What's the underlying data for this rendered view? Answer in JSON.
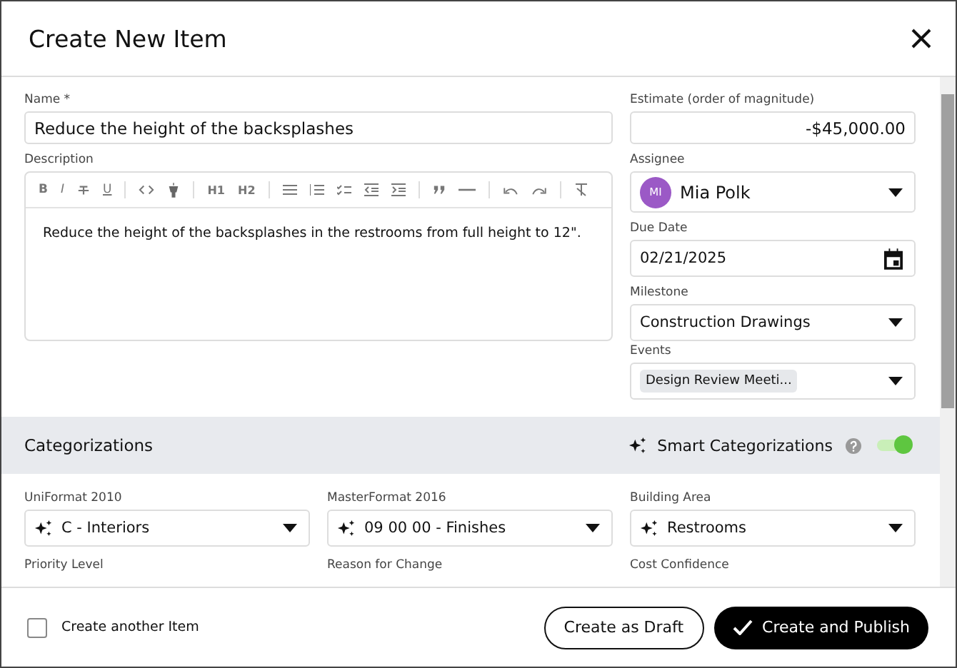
{
  "dialog": {
    "title": "Create New Item"
  },
  "name_field": {
    "label": "Name",
    "required_mark": "*",
    "value": "Reduce the height of the backsplashes"
  },
  "description": {
    "label": "Description",
    "toolbar": {
      "bold": "B",
      "italic": "I",
      "underline": "U",
      "h1": "H1",
      "h2": "H2"
    },
    "value": "Reduce the height of the backsplashes in the restrooms from full height to 12\"."
  },
  "estimate": {
    "label": "Estimate (order of magnitude)",
    "value": "-$45,000.00"
  },
  "assignee": {
    "label": "Assignee",
    "initials": "MI",
    "value": "Mia Polk",
    "color": "#9b59c6"
  },
  "due_date": {
    "label": "Due Date",
    "value": "02/21/2025"
  },
  "milestone": {
    "label": "Milestone",
    "value": "Construction Drawings"
  },
  "events": {
    "label": "Events",
    "chips": [
      "Design Review Meeti..."
    ]
  },
  "categorizations": {
    "title": "Categorizations",
    "smart_label": "Smart Categorizations",
    "smart_on": true,
    "fields": [
      {
        "label": "UniFormat 2010",
        "value": "C - Interiors",
        "smart": true
      },
      {
        "label": "MasterFormat 2016",
        "value": "09 00 00 - Finishes",
        "smart": true
      },
      {
        "label": "Building Area",
        "value": "Restrooms",
        "smart": true
      },
      {
        "label": "Priority Level"
      },
      {
        "label": "Reason for Change"
      },
      {
        "label": "Cost Confidence"
      }
    ]
  },
  "footer": {
    "create_another": {
      "label": "Create another Item",
      "checked": false
    },
    "buttons": [
      {
        "kind": "secondary",
        "label": "Create as Draft"
      },
      {
        "kind": "primary",
        "label": "Create and Publish"
      }
    ]
  }
}
